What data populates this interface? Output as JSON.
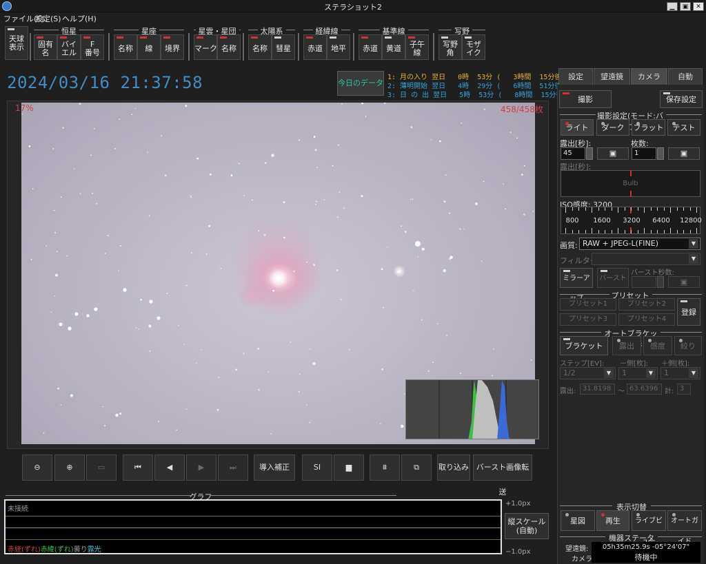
{
  "window": {
    "title": "ステラショット2",
    "min": "▁",
    "max": "▣",
    "close": "✕"
  },
  "menu": [
    {
      "label": "ファイル(F)"
    },
    {
      "label": "設定(S)"
    },
    {
      "label": "ヘルプ(H)"
    }
  ],
  "toolbar": {
    "sky_view": "天球\n表示",
    "groups": [
      {
        "title": "恒星",
        "buttons": [
          "固有\n名",
          "バイ\nエル",
          "F\n番号"
        ]
      },
      {
        "title": "星座",
        "buttons": [
          "名称",
          "線",
          "境界"
        ]
      },
      {
        "title": "星雲・星団",
        "buttons": [
          "マーク",
          "名称"
        ]
      },
      {
        "title": "太陽系",
        "buttons": [
          "名称",
          "彗星"
        ]
      },
      {
        "title": "経緯線",
        "buttons": [
          "赤道",
          "地平"
        ]
      },
      {
        "title": "基準線",
        "buttons": [
          "赤道",
          "黄道",
          "子午\n線"
        ]
      },
      {
        "title": "写野",
        "buttons": [
          "写野\n角",
          "モザ\nイク"
        ]
      }
    ]
  },
  "datetime": "2024/03/16  21:37:58",
  "today_button": "今日のデータ",
  "events": [
    {
      "text": "1: 月の入り 翌日   0時  53分 (   3時間  15分後)",
      "color": "#e6b23a"
    },
    {
      "text": "2: 薄明開始 翌日   4時  29分 (   6時間  51分後)",
      "color": "#3aa0d8"
    },
    {
      "text": "3: 日 の 出 翌日   5時  53分 (   8時間  15分後)",
      "color": "#3aa0d8"
    }
  ],
  "image": {
    "progress_label": "17%",
    "progress_fraction": 0.17,
    "count_label": "458/458枚"
  },
  "controls": {
    "zoom_out": "⊖",
    "zoom_in": "⊕",
    "fit": "▭",
    "first": "⏮",
    "prev": "◀",
    "play": "▶",
    "last": "⏭",
    "guide_correct": "導入補正",
    "si": "SI",
    "folder": "▆",
    "hist": "⩩",
    "compare": "⧉",
    "capture": "取り込み",
    "burst_transfer": "バースト画像転送"
  },
  "graph": {
    "title": "グラフ",
    "status": "未接続",
    "top_scale": "+1.0px",
    "bottom_scale": "−1.0px",
    "scale_button": "縦スケール\n(自動)",
    "legend": [
      {
        "text": "赤経(ずれ)",
        "color": "#d04040"
      },
      {
        "text": "赤緯(ずれ)",
        "color": "#3ac040"
      },
      {
        "text": "曇り",
        "color": "#9a9a9a"
      },
      {
        "text": "露光",
        "color": "#3ac0e0"
      }
    ]
  },
  "panel": {
    "tabs": [
      "設定",
      "望遠鏡",
      "カメラ",
      "自動"
    ],
    "shoot": "撮影",
    "save_settings": "保存設定",
    "shoot_settings_title": "撮影設定(モード:バルブ)",
    "modes": [
      "ライト",
      "ダーク",
      "フラット",
      "テスト"
    ],
    "exposure_label": "露出[秒]:",
    "exposure_value": "45",
    "frames_label": "枚数:",
    "frames_value": "1",
    "bulb_label": "露出[秒]:",
    "bulb_value": "Bulb",
    "iso_label": "ISO感度: 3200",
    "iso_ticks": [
      "800",
      "1600",
      "3200",
      "6400",
      "12800"
    ],
    "quality_label": "画質:",
    "quality_value": "RAW + JPEG-L(FINE)",
    "filter_label": "フィルター:",
    "filter_value": "",
    "mirror_up": "ミラーアップ",
    "burst": "バースト",
    "burst_sec_label": "バースト秒数:",
    "preset_title": "プリセット",
    "presets": [
      "プリセット1",
      "プリセット2",
      "プリセット3",
      "プリセット4"
    ],
    "register": "登録",
    "bracket_title": "オートブラケット撮影",
    "bracket": "ブラケット",
    "bracket_modes": [
      "露出",
      "感度",
      "絞り"
    ],
    "step_label": "ステップ[EV]:",
    "minus_label": "－側[枚]:",
    "plus_label": "＋側[枚]:",
    "step_value": "1/2",
    "minus_value": "1",
    "plus_value": "1",
    "exp_range_label": "露出:",
    "exp_min": "31.8198",
    "tilde": "〜",
    "exp_max": "63.6396",
    "total_label": "計:",
    "total_value": "3",
    "display_switch_title": "表示切替",
    "display_buttons": [
      "星図",
      "再生",
      "ライブビュー",
      "オートガイド"
    ],
    "device_status_title": "機器ステータス",
    "telescope_label": "望遠鏡:",
    "telescope_value": "05h35m25.9s  -05°24'07\"",
    "camera_label": "カメラ:",
    "camera_value": "待機中"
  },
  "colors": {
    "accent_blue": "#3d8fc4",
    "led_red": "#d03030",
    "nebula_pink": "#e3a3bd"
  }
}
